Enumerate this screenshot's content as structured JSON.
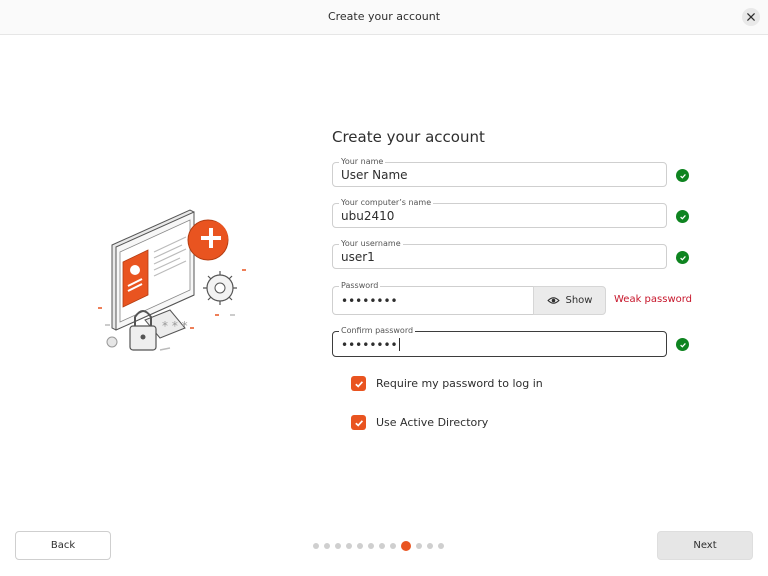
{
  "window": {
    "title": "Create your account"
  },
  "form": {
    "heading": "Create your account",
    "name": {
      "label": "Your name",
      "value": "User Name"
    },
    "computer": {
      "label": "Your computer’s name",
      "value": "ubu2410"
    },
    "username": {
      "label": "Your username",
      "value": "user1"
    },
    "password": {
      "label": "Password",
      "value": "••••••••",
      "show_label": "Show",
      "strength": "Weak password"
    },
    "confirm": {
      "label": "Confirm password",
      "value": "••••••••"
    },
    "require_password": {
      "label": "Require my password to log in",
      "checked": true
    },
    "active_directory": {
      "label": "Use Active Directory",
      "checked": true
    }
  },
  "footer": {
    "back_label": "Back",
    "next_label": "Next",
    "pager": {
      "total": 12,
      "current": 9
    }
  },
  "colors": {
    "accent": "#e95420",
    "success": "#0e8420",
    "error": "#c7162b"
  }
}
